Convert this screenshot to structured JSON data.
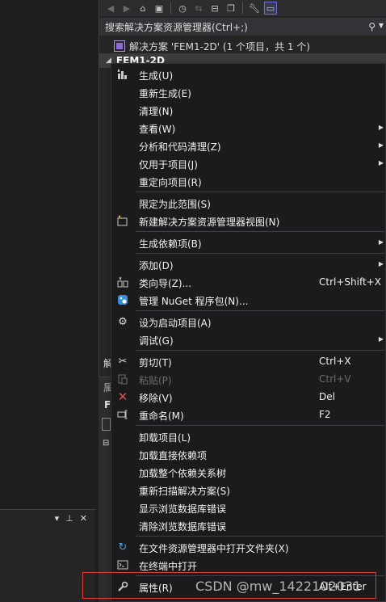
{
  "solution_explorer": {
    "search_placeholder": "搜索解决方案资源管理器(Ctrl+;)",
    "solution_row": "解决方案 'FEM1-2D' (1 个项目，共 1 个)",
    "project_row": "FEM1-2D"
  },
  "background_fragments": {
    "f1": "解",
    "f2": "属",
    "f3": "F"
  },
  "context_menu": {
    "items": [
      {
        "label": "生成(U)",
        "icon": "build-icon"
      },
      {
        "label": "重新生成(E)"
      },
      {
        "label": "清理(N)"
      },
      {
        "label": "查看(W)",
        "submenu": true
      },
      {
        "label": "分析和代码清理(Z)",
        "submenu": true
      },
      {
        "label": "仅用于项目(J)",
        "submenu": true
      },
      {
        "label": "重定向项目(R)"
      },
      {
        "label": "限定为此范围(S)"
      },
      {
        "label": "新建解决方案资源管理器视图(N)",
        "icon": "new-view-icon"
      },
      {
        "label": "生成依赖项(B)",
        "submenu": true
      },
      {
        "label": "添加(D)",
        "submenu": true
      },
      {
        "label": "类向导(Z)...",
        "shortcut": "Ctrl+Shift+X",
        "icon": "class-wizard-icon"
      },
      {
        "label": "管理 NuGet 程序包(N)...",
        "icon": "nuget-icon"
      },
      {
        "label": "设为启动项目(A)",
        "icon": "gear-icon"
      },
      {
        "label": "调试(G)",
        "submenu": true
      },
      {
        "label": "剪切(T)",
        "shortcut": "Ctrl+X",
        "icon": "cut-icon"
      },
      {
        "label": "粘贴(P)",
        "shortcut": "Ctrl+V",
        "icon": "paste-icon",
        "disabled": true
      },
      {
        "label": "移除(V)",
        "shortcut": "Del",
        "icon": "remove-icon"
      },
      {
        "label": "重命名(M)",
        "shortcut": "F2",
        "icon": "rename-icon"
      },
      {
        "label": "卸载项目(L)"
      },
      {
        "label": "加载直接依赖项"
      },
      {
        "label": "加载整个依赖关系树"
      },
      {
        "label": "重新扫描解决方案(S)"
      },
      {
        "label": "显示浏览数据库错误"
      },
      {
        "label": "清除浏览数据库错误"
      },
      {
        "label": "在文件资源管理器中打开文件夹(X)",
        "icon": "refresh-icon"
      },
      {
        "label": "在终端中打开",
        "icon": "terminal-icon"
      },
      {
        "label": "属性(R)",
        "shortcut": "Alt+Enter",
        "icon": "wrench-icon"
      }
    ]
  },
  "watermark": "CSDN @mw_1422102031",
  "colors": {
    "menu_bg": "#1b1b1c",
    "highlight_border": "#e03a3a",
    "solution_icon": "#8e6bd8",
    "remove_icon": "#e05252",
    "nuget_icon": "#3a8fd6"
  }
}
